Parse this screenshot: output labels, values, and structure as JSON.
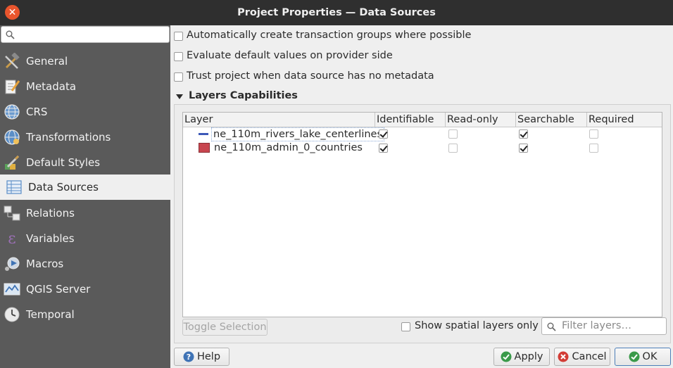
{
  "window": {
    "title": "Project Properties — Data Sources"
  },
  "sidebar": {
    "search_placeholder": "",
    "items": [
      {
        "label": "General",
        "icon": "hammer-icon"
      },
      {
        "label": "Metadata",
        "icon": "document-pen-icon"
      },
      {
        "label": "CRS",
        "icon": "globe-icon"
      },
      {
        "label": "Transformations",
        "icon": "globe-transform-icon"
      },
      {
        "label": "Default Styles",
        "icon": "paintbrush-icon"
      },
      {
        "label": "Data Sources",
        "icon": "data-table-icon",
        "selected": true
      },
      {
        "label": "Relations",
        "icon": "relations-icon"
      },
      {
        "label": "Variables",
        "icon": "epsilon-icon"
      },
      {
        "label": "Macros",
        "icon": "macro-gear-icon"
      },
      {
        "label": "QGIS Server",
        "icon": "server-map-icon"
      },
      {
        "label": "Temporal",
        "icon": "clock-icon"
      }
    ]
  },
  "options": [
    {
      "label": "Automatically create transaction groups where possible",
      "checked": false
    },
    {
      "label": "Evaluate default values on provider side",
      "checked": false
    },
    {
      "label": "Trust project when data source has no metadata",
      "checked": false
    }
  ],
  "layers_section": {
    "title": "Layers Capabilities",
    "columns": [
      "Layer",
      "Identifiable",
      "Read-only",
      "Searchable",
      "Required"
    ],
    "rows": [
      {
        "name": "ne_110m_rivers_lake_centerlines",
        "symbol": "line",
        "symbol_color": "#3d59b8",
        "identifiable": true,
        "read_only": false,
        "searchable": true,
        "required": false
      },
      {
        "name": "ne_110m_admin_0_countries",
        "symbol": "polygon",
        "symbol_color": "#c8464f",
        "identifiable": true,
        "read_only": false,
        "searchable": true,
        "required": false
      }
    ],
    "toggle_selection_label": "Toggle Selection",
    "show_spatial_label": "Show spatial layers only",
    "show_spatial_checked": false,
    "filter_placeholder": "Filter layers…"
  },
  "buttons": {
    "help": "Help",
    "apply": "Apply",
    "cancel": "Cancel",
    "ok": "OK"
  }
}
